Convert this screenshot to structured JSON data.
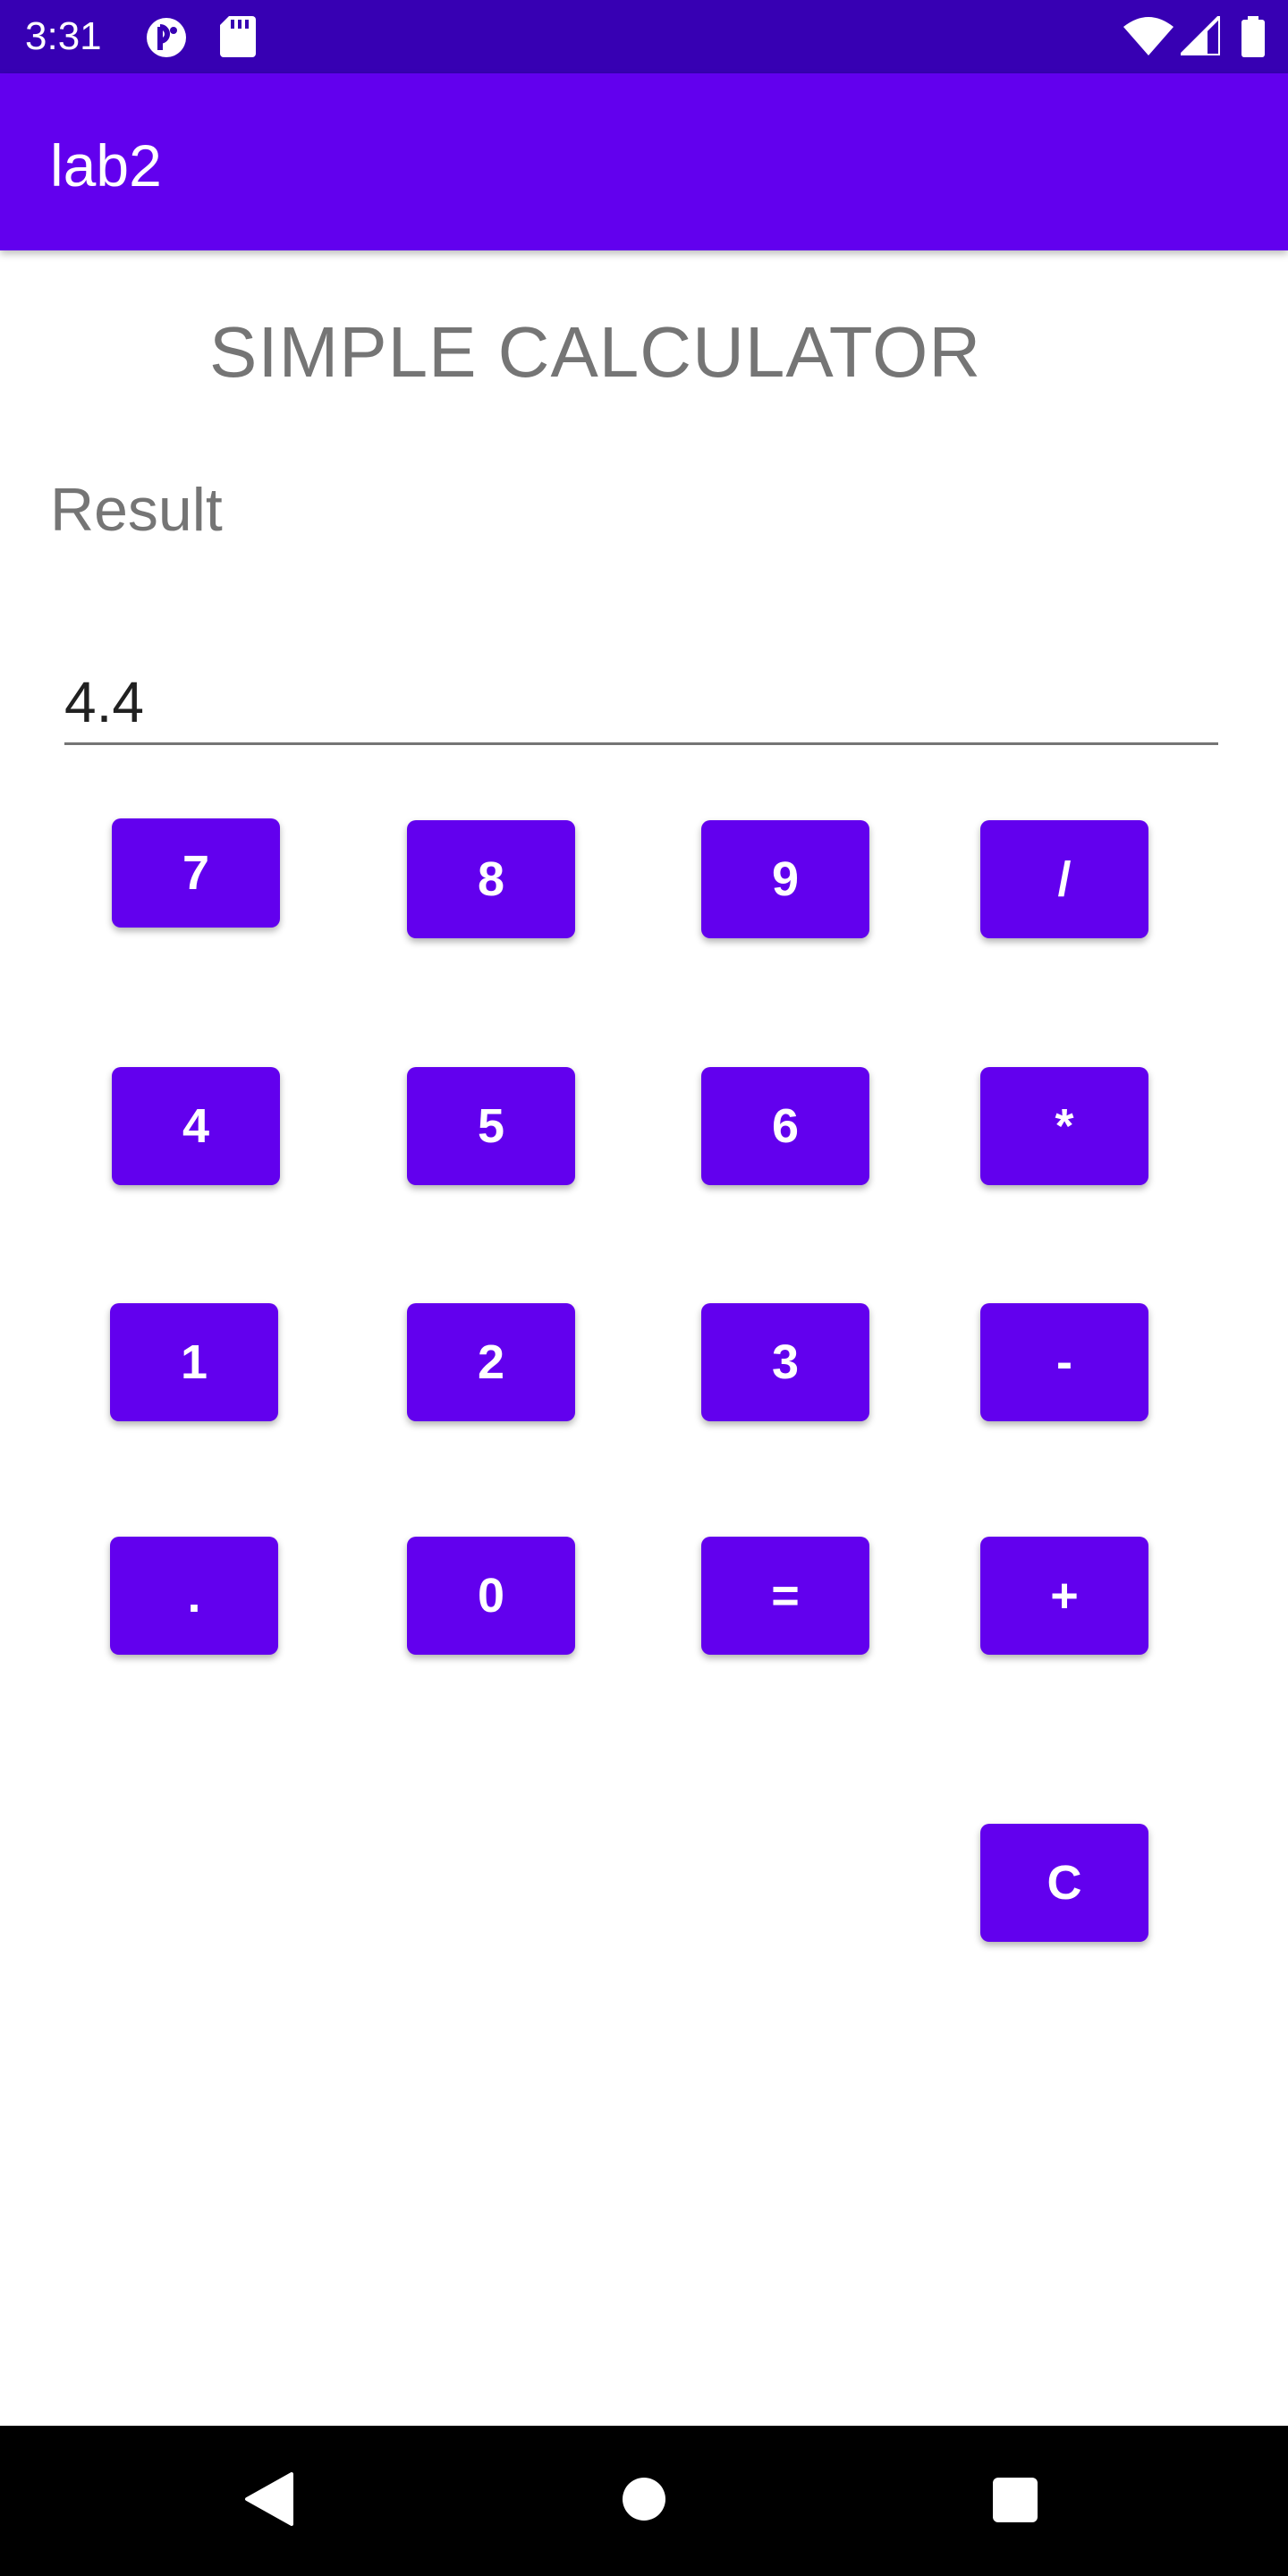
{
  "status_bar": {
    "time": "3:31",
    "left_icons": [
      "notification-app-icon",
      "sd-card-icon"
    ],
    "right_icons": [
      "wifi-icon",
      "cell-signal-icon",
      "battery-icon"
    ]
  },
  "app_bar": {
    "title": "lab2"
  },
  "heading": "SIMPLE CALCULATOR",
  "result_label": "Result",
  "result_value": "4.4",
  "buttons": {
    "seven": "7",
    "eight": "8",
    "nine": "9",
    "divide": "/",
    "four": "4",
    "five": "5",
    "six": "6",
    "multiply": "*",
    "one": "1",
    "two": "2",
    "three": "3",
    "subtract": "-",
    "decimal": ".",
    "zero": "0",
    "equals": "=",
    "add": "+",
    "clear": "C"
  },
  "nav_bar": {
    "icons": [
      "back-icon",
      "home-icon",
      "recents-icon"
    ]
  },
  "colors": {
    "primary": "#6200ee",
    "primary_dark": "#3700b3",
    "text_secondary": "#757575"
  }
}
